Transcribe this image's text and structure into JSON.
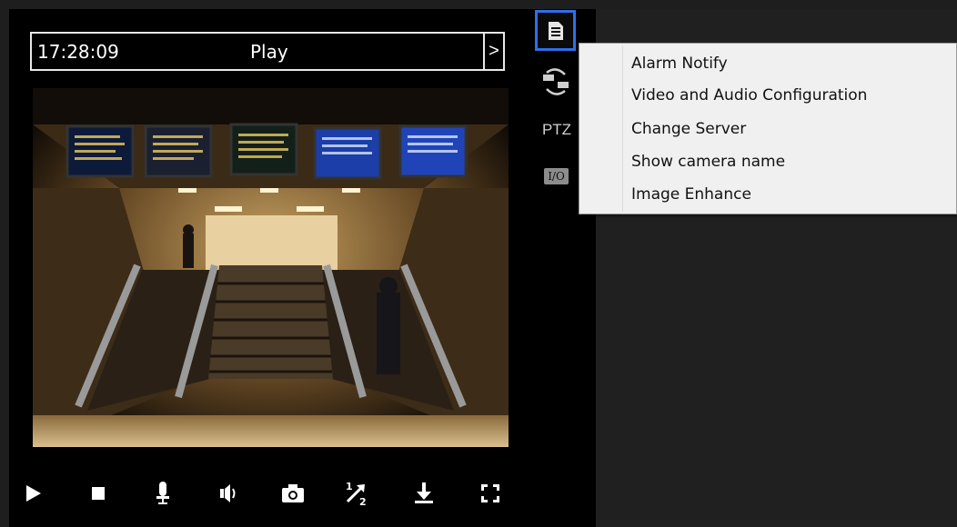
{
  "player": {
    "time": "17:28:09",
    "mode": "Play",
    "next_glyph": ">"
  },
  "side_toolbar": {
    "menu_icon": "document-menu-icon",
    "switch_icon": "camera-switch-icon",
    "ptz_label": "PTZ",
    "io_label": "I/O"
  },
  "context_menu": {
    "items": [
      "Alarm Notify",
      "Video and Audio Configuration",
      "Change Server",
      "Show camera name",
      "Image Enhance"
    ]
  },
  "controls": {
    "icons": [
      "play-icon",
      "stop-icon",
      "microphone-icon",
      "speaker-icon",
      "snapshot-icon",
      "half-speed-icon",
      "download-icon",
      "fullscreen-icon"
    ],
    "speed_fraction": "1/2"
  },
  "colors": {
    "menu_highlight_border": "#2f6fe8",
    "panel_background": "#000000",
    "menu_background": "#f0f0f0"
  }
}
